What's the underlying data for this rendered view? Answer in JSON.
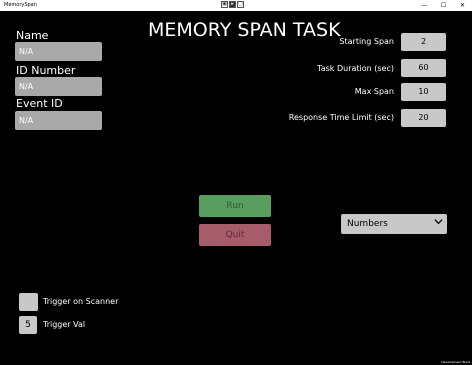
{
  "window": {
    "app_name": "MemorySpan",
    "minimize_glyph": "—",
    "maximize_glyph": "☐",
    "close_glyph": "✕"
  },
  "title": "MEMORY SPAN TASK",
  "left_fields": [
    {
      "label": "Name",
      "value": "N/A"
    },
    {
      "label": "ID Number",
      "value": "N/A"
    },
    {
      "label": "Event ID",
      "value": "N/A"
    }
  ],
  "params": [
    {
      "label": "Starting Span",
      "value": "2"
    },
    {
      "label": "Task Duration (sec)",
      "value": "60"
    },
    {
      "label": "Max Span",
      "value": "10"
    },
    {
      "label": "Response Time Limit (sec)",
      "value": "20"
    }
  ],
  "buttons": {
    "run": "Run",
    "quit": "Quit"
  },
  "mode_select": {
    "selected": "Numbers",
    "icon": "chevron-down-icon"
  },
  "trigger": {
    "scanner_label": "Trigger on Scanner",
    "val_label": "Trigger Val",
    "val": "5"
  },
  "footer": {
    "dev_mode": "Development Build"
  }
}
